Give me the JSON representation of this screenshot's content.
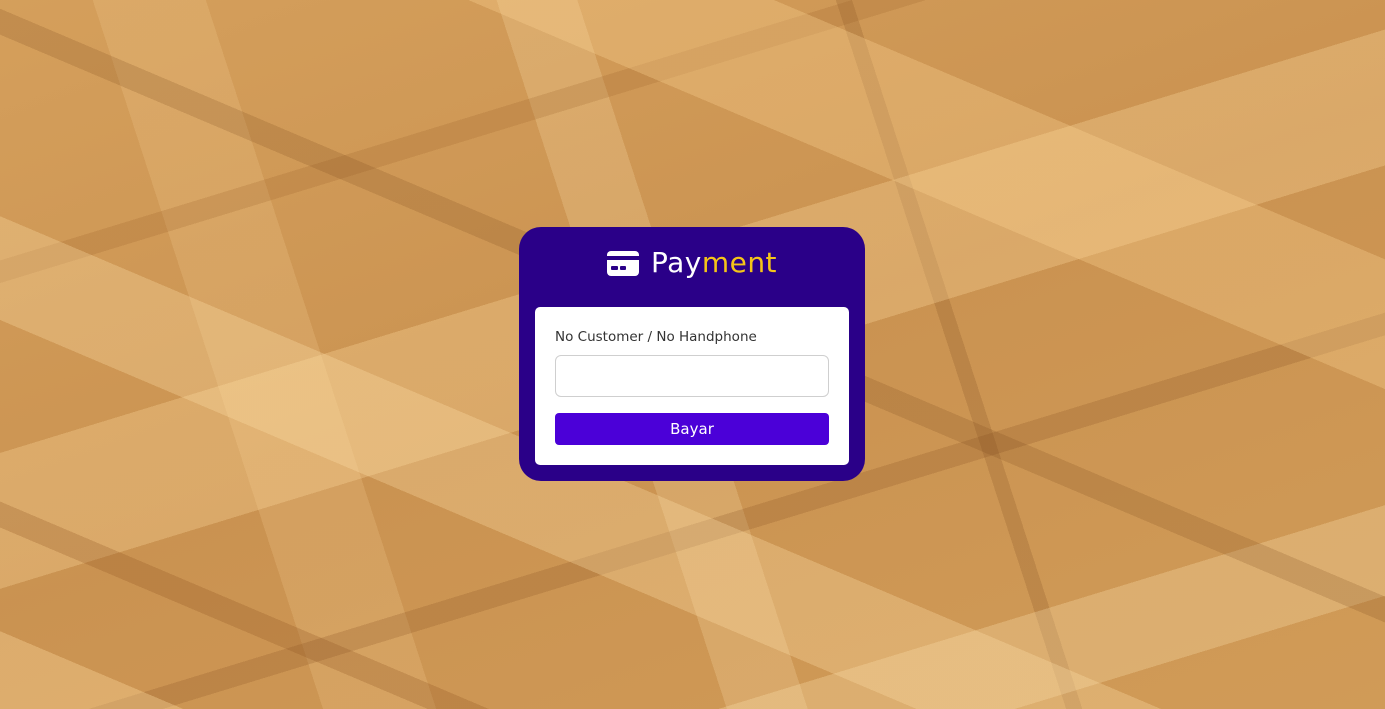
{
  "background": {
    "texture": "wooden particle board (OSB)"
  },
  "brand": {
    "icon": "credit-card-icon",
    "title_part1": "Pay",
    "title_part2": "ment",
    "color_part1": "#ffffff",
    "color_part2": "#f5c518"
  },
  "form": {
    "label": "No Customer / No Handphone",
    "input_value": "",
    "input_placeholder": "",
    "submit_label": "Bayar"
  },
  "colors": {
    "card_background": "#2a0088",
    "button_background": "#4b00d8",
    "panel_background": "#ffffff"
  }
}
